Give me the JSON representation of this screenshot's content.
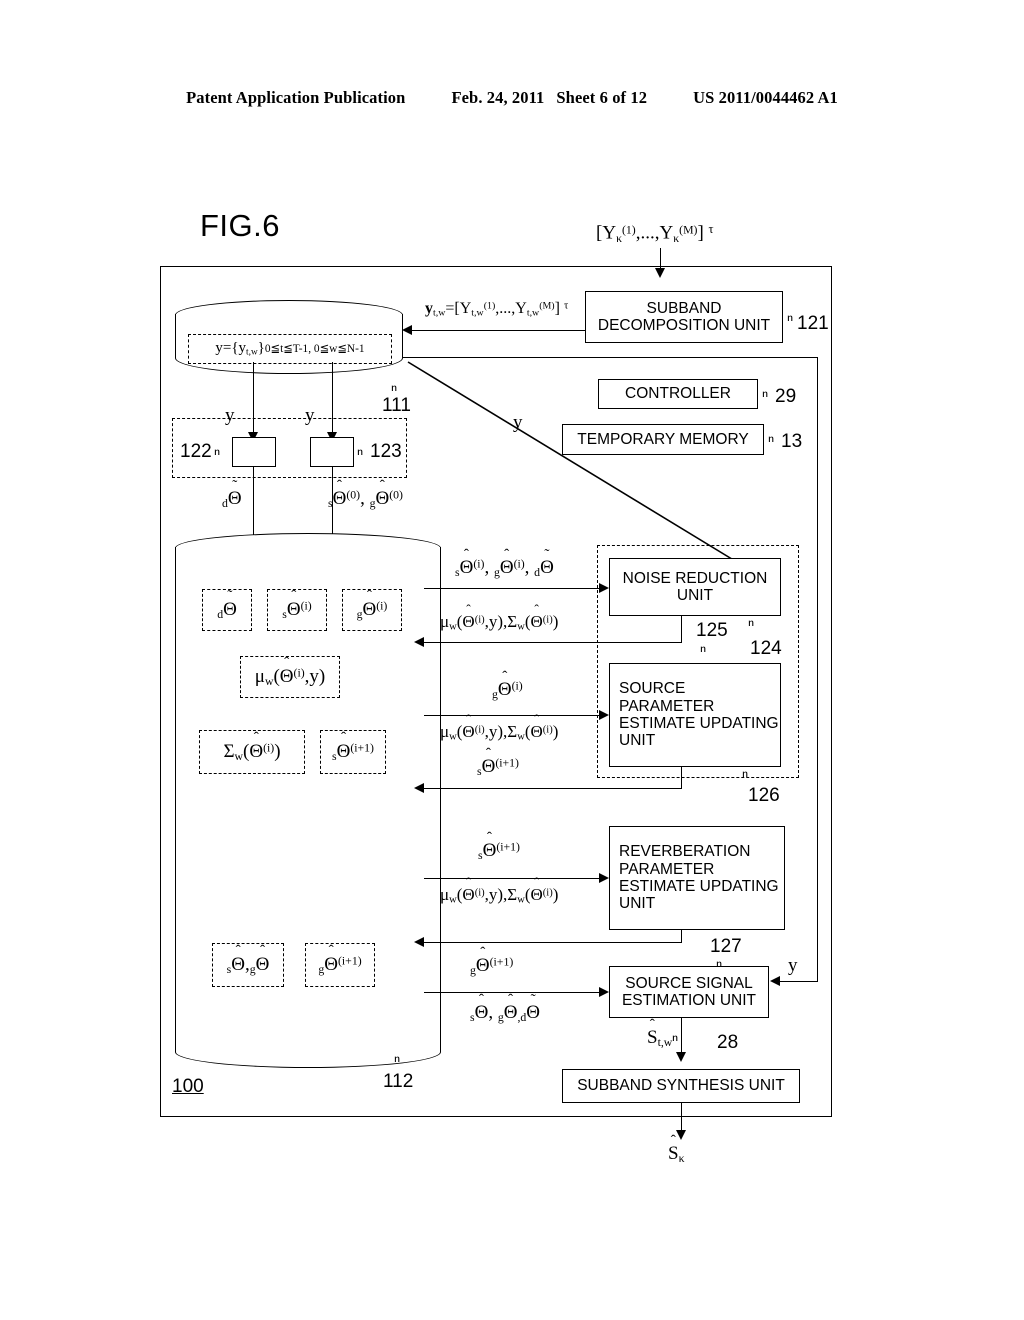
{
  "header": {
    "left": "Patent Application Publication",
    "date": "Feb. 24, 2011",
    "sheet": "Sheet 6 of 12",
    "patent_number": "US 2011/0044462 A1"
  },
  "figure": {
    "title": "FIG.6",
    "outer_ref": "100"
  },
  "inputs": {
    "top_signal": "[Yκ(1),...,Yκ(M)]T",
    "subband_output": "yt,w=[Yt,w(1),...,Yt,w(M)]T"
  },
  "storage": {
    "upper_cylinder_content": "y={yt,w}0≦t≦T-1, 0≦w≦N-1",
    "upper_cylinder_ref": "111",
    "lower_cylinder_ref": "112",
    "lower_items": [
      {
        "label": "dΘ̃",
        "ref": "d-theta-tilde"
      },
      {
        "label": "sΘ̂(i)",
        "ref": "s-theta-hat-i"
      },
      {
        "label": "gΘ̂(i)",
        "ref": "g-theta-hat-i"
      },
      {
        "label": "μw(Θ̂(i),y)",
        "ref": "mu-w"
      },
      {
        "label": "Σw(Θ̂(i))",
        "ref": "sigma-w"
      },
      {
        "label": "sΘ̂(i+1)",
        "ref": "s-theta-hat-i1"
      },
      {
        "label": "sΘ̂,gΘ̂",
        "ref": "s-g-theta-hat"
      },
      {
        "label": "gΘ̂(i+1)",
        "ref": "g-theta-hat-i1"
      }
    ]
  },
  "units": {
    "subband_decomposition": {
      "label": "SUBBAND DECOMPOSITION UNIT",
      "ref": "121"
    },
    "controller": {
      "label": "CONTROLLER",
      "ref": "29"
    },
    "temporary_memory": {
      "label": "TEMPORARY MEMORY",
      "ref": "13"
    },
    "noise_reduction": {
      "label": "NOISE REDUCTION UNIT",
      "ref": "125"
    },
    "source_parameter": {
      "label": "SOURCE PARAMETER ESTIMATE UPDATING UNIT",
      "ref": "126"
    },
    "reverberation_parameter": {
      "label": "REVERBERATION PARAMETER ESTIMATE UPDATING UNIT",
      "ref": "127"
    },
    "source_signal_estimation": {
      "label": "SOURCE SIGNAL ESTIMATION UNIT",
      "ref": "28"
    },
    "subband_synthesis": {
      "label": "SUBBAND SYNTHESIS UNIT",
      "ref": ""
    },
    "dashed_group_ref": "124",
    "init_block_left_ref": "122",
    "init_block_right_ref": "123"
  },
  "signals": {
    "y": "y",
    "d_theta_tilde": "dΘ̃",
    "s_g_theta_hat_0": "sΘ̂(0), gΘ̂(0)",
    "nr_in": "sΘ̂(i), gΘ̂(i), dΘ̃",
    "nr_out": "μw(Θ̂(i),y),Σw(Θ̂(i))",
    "sp_in": "gΘ̂(i)",
    "sp_in2": "μw(Θ̂(i),y),Σw(Θ̂(i))",
    "sp_out": "sΘ̂(i+1)",
    "rp_in": "sΘ̂(i+1)",
    "rp_in2": "μw(Θ̂(i),y),Σw(Θ̂(i))",
    "rp_out": "gΘ̂(i+1)",
    "ss_in": "sΘ̂, gΘ̂, dΘ̃",
    "ss_y": "y",
    "ss_out": "ŝt,w",
    "final_out": "ŝκ"
  }
}
